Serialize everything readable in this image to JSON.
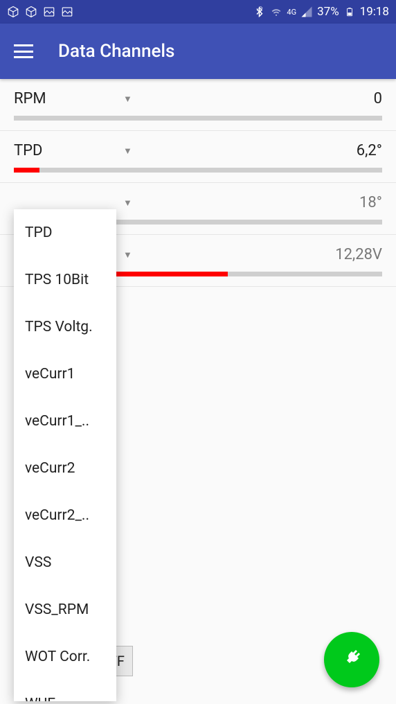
{
  "status": {
    "battery": "37%",
    "time": "19:18",
    "network": "4G"
  },
  "header": {
    "title": "Data Channels"
  },
  "rows": [
    {
      "label": "RPM",
      "value": "0",
      "fill": 0,
      "dark": true
    },
    {
      "label": "TPD",
      "value": "6,2°",
      "fill": 7,
      "dark": true
    },
    {
      "label": "",
      "value": "18°",
      "fill": 0,
      "dark": false
    },
    {
      "label": "",
      "value": "12,28V",
      "fill": 58,
      "dark": false
    }
  ],
  "dropdown": {
    "items": [
      "TPD",
      "TPS 10Bit",
      "TPS Voltg.",
      "veCurr1",
      "veCurr1_..",
      "veCurr2",
      "veCurr2_..",
      "VSS",
      "VSS_RPM",
      "WOT Corr.",
      "WUE"
    ]
  },
  "buttons": {
    "off": "OFF"
  }
}
